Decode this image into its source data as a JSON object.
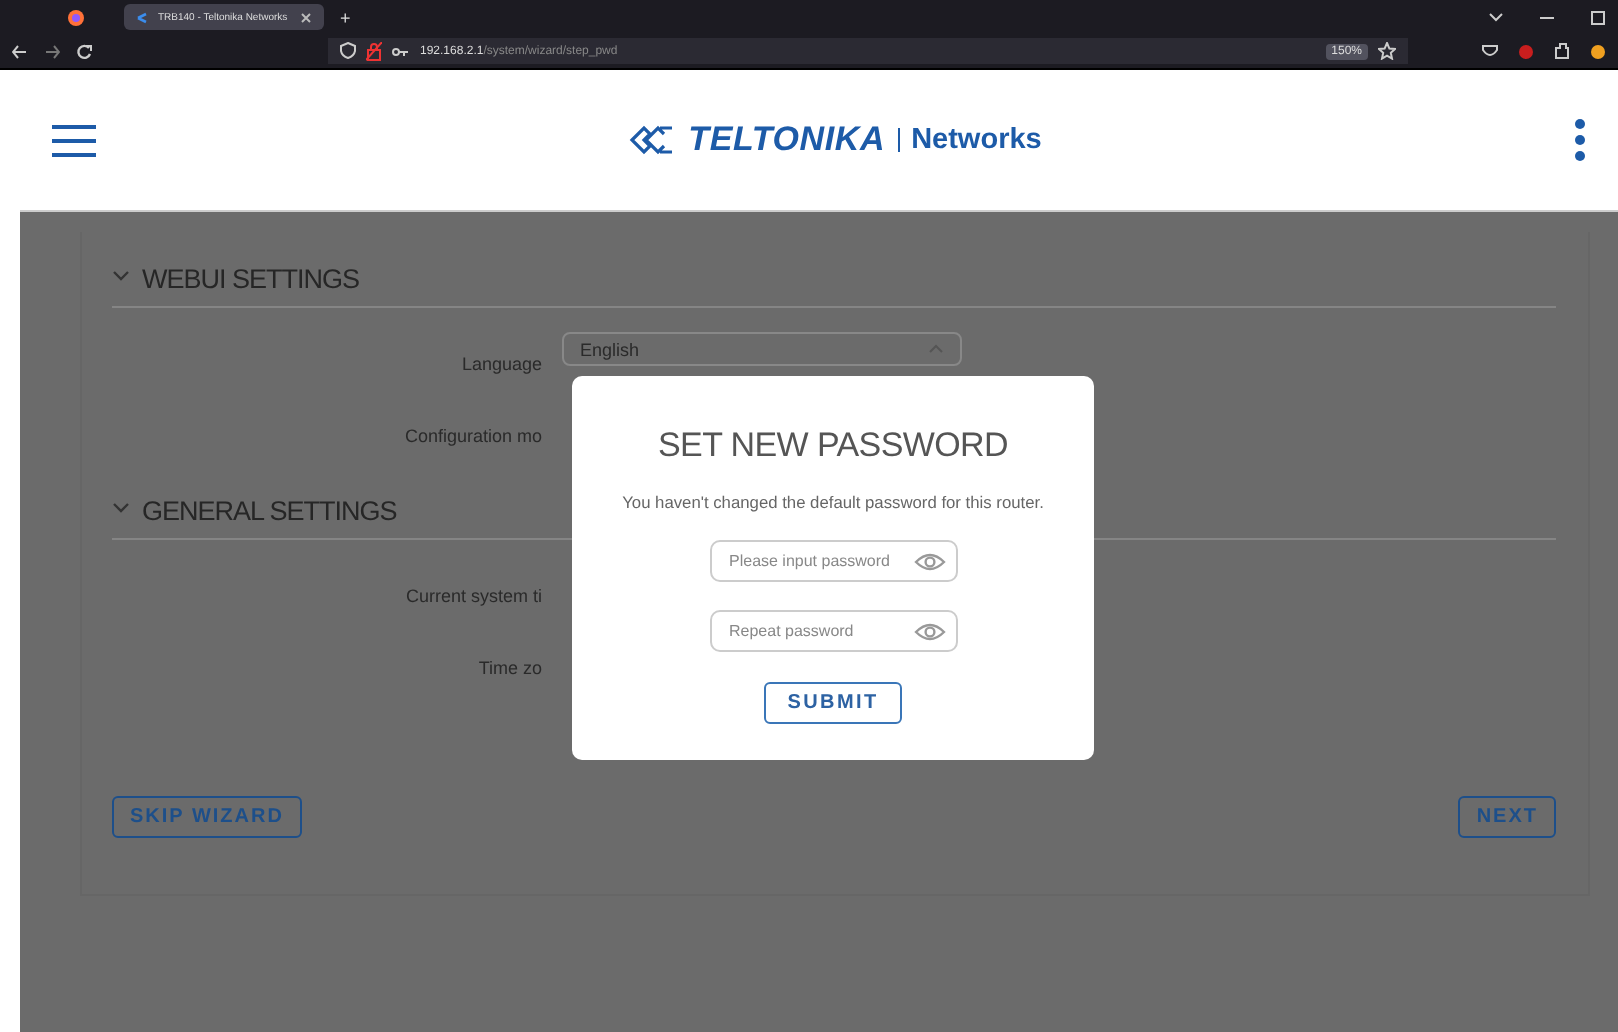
{
  "browser": {
    "tab_title": "TRB140 - Teltonika Networks",
    "new_tab": "+",
    "url_host": "192.168.2.1",
    "url_path": "/system/wizard/step_pwd",
    "zoom": "150%"
  },
  "header": {
    "brand": "TELTONIKA",
    "product": "Networks"
  },
  "sections": [
    {
      "title": "WEBUI SETTINGS",
      "expanded": true,
      "fields": [
        {
          "label": "Language",
          "value": "English"
        },
        {
          "label": "Configuration mo"
        }
      ]
    },
    {
      "title": "GENERAL SETTINGS",
      "expanded": true,
      "fields": [
        {
          "label": "Current system ti"
        },
        {
          "label": "Time zo"
        }
      ]
    }
  ],
  "buttons": {
    "skip": "SKIP WIZARD",
    "next": "NEXT"
  },
  "modal": {
    "title": "SET NEW PASSWORD",
    "message": "You haven't changed the default password for this router.",
    "fields": [
      {
        "placeholder": "Please input password"
      },
      {
        "placeholder": "Repeat password"
      }
    ],
    "submit": "SUBMIT"
  }
}
